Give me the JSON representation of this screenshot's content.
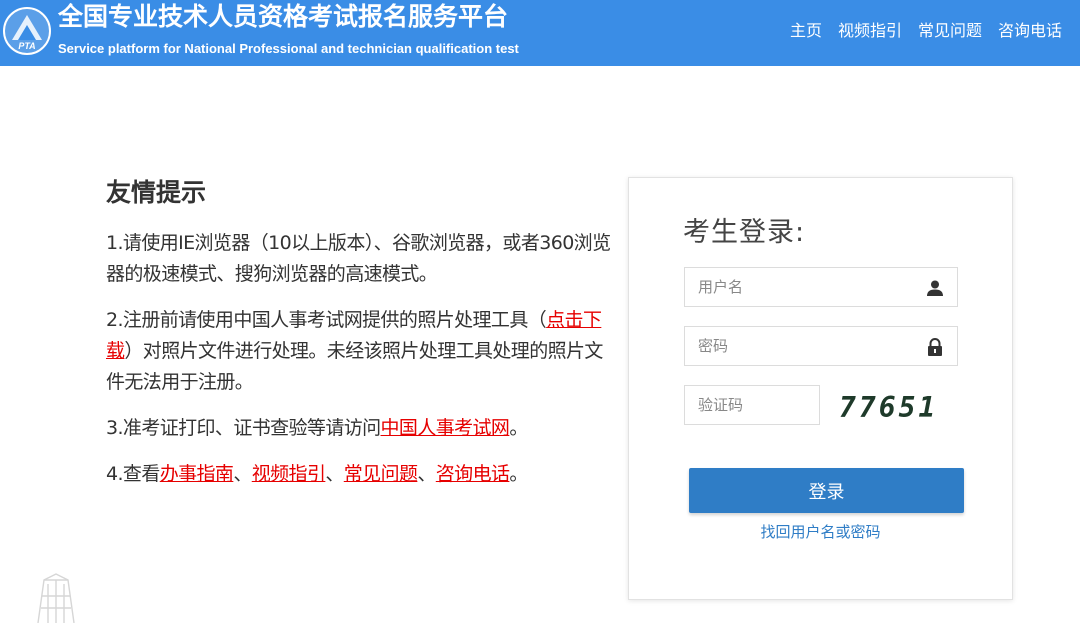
{
  "header": {
    "title": "全国专业技术人员资格考试报名服务平台",
    "subtitle": "Service platform for National Professional and technician qualification test",
    "logo_text": "PTA",
    "nav": [
      {
        "label": "主页"
      },
      {
        "label": "视频指引"
      },
      {
        "label": "常见问题"
      },
      {
        "label": "咨询电话"
      }
    ],
    "background_color": "#3a8de6"
  },
  "notice": {
    "title": "友情提示",
    "item1": {
      "text": "1.请使用IE浏览器（10以上版本）、谷歌浏览器，或者360浏览器的极速模式、搜狗浏览器的高速模式。"
    },
    "item2": {
      "prefix": "2.注册前请使用中国人事考试网提供的照片处理工具（",
      "link": "点击下载",
      "suffix": "）对照片文件进行处理。未经该照片处理工具处理的照片文件无法用于注册。"
    },
    "item3": {
      "prefix": "3.准考证打印、证书查验等请访问",
      "link": "中国人事考试网",
      "suffix": "。"
    },
    "item4": {
      "prefix": "4.查看",
      "links": [
        "办事指南",
        "视频指引",
        "常见问题",
        "咨询电话"
      ],
      "separator": "、",
      "suffix": "。"
    },
    "link_color": "#e60000"
  },
  "login": {
    "title": "考生登录:",
    "username_placeholder": "用户名",
    "password_placeholder": "密码",
    "captcha_placeholder": "验证码",
    "captcha_value": "77651",
    "button_label": "登录",
    "forgot_link": "找回用户名或密码",
    "button_color": "#2f7dc6"
  }
}
